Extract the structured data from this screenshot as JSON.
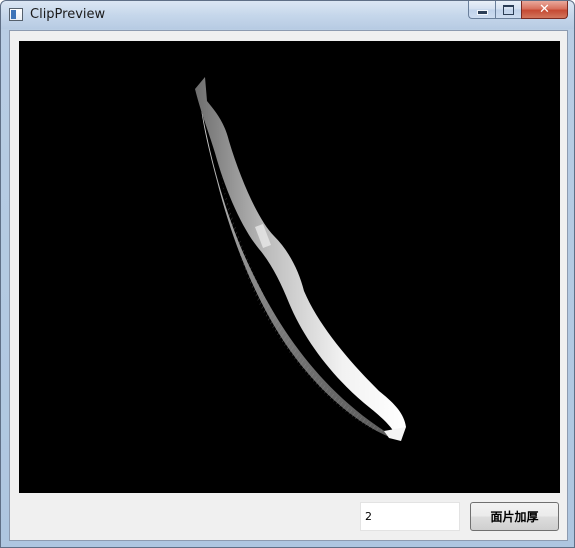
{
  "window": {
    "title": "ClipPreview",
    "icon": "app-window-icon",
    "caption_buttons": [
      "minimize-icon",
      "maximize-icon",
      "close-icon"
    ],
    "close_glyph": "✕"
  },
  "viewport": {
    "background": "#000000",
    "content": "rendered-3d-mesh"
  },
  "controls": {
    "thickness_value": "2",
    "thicken_button_label": "面片加厚"
  }
}
